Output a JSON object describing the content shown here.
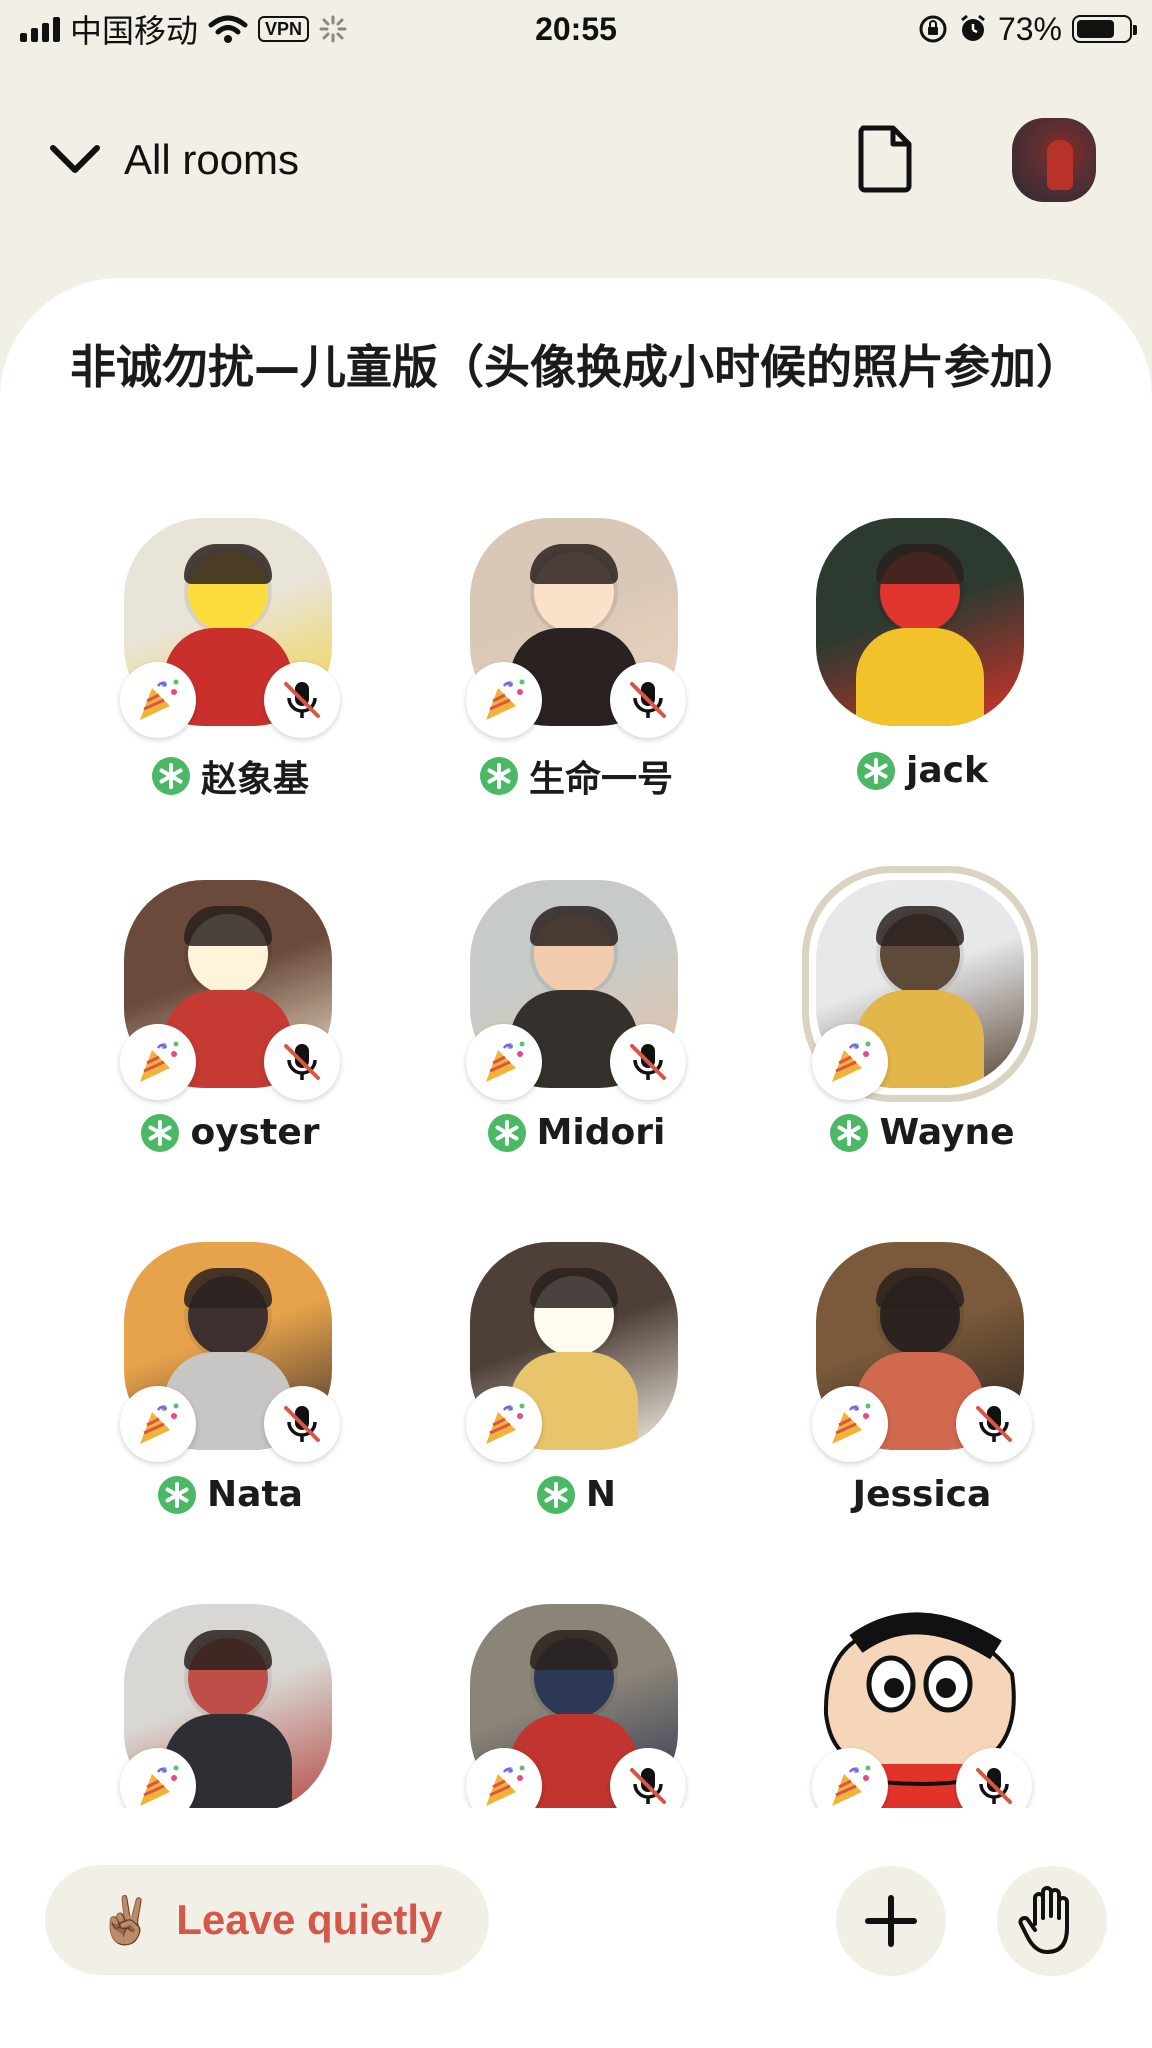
{
  "status_bar": {
    "carrier": "中国移动",
    "vpn": "VPN",
    "time": "20:55",
    "battery_percent": "73%",
    "battery_level": 0.73
  },
  "nav": {
    "all_rooms_label": "All rooms",
    "icons": [
      "chevron-down-icon",
      "document-icon"
    ]
  },
  "room": {
    "title": "非诚勿扰—儿童版（头像换成小时候的照片参加）"
  },
  "speakers": [
    {
      "name": "赵象基",
      "new_user": true,
      "muted": true,
      "party": true,
      "colors": [
        "#e9e4d8",
        "#c9302c",
        "#f1d23b"
      ]
    },
    {
      "name": "生命一号",
      "new_user": true,
      "muted": true,
      "party": true,
      "colors": [
        "#d9c8b7",
        "#2a2220",
        "#f0d6c0"
      ]
    },
    {
      "name": "jack",
      "new_user": true,
      "muted": false,
      "party": false,
      "colors": [
        "#2d3a30",
        "#f2c22a",
        "#d5332b"
      ]
    },
    {
      "name": "oyster",
      "new_user": true,
      "muted": true,
      "party": true,
      "colors": [
        "#6a4a3a",
        "#c63a34",
        "#f3e7cf"
      ]
    },
    {
      "name": "Midori",
      "new_user": true,
      "muted": true,
      "party": true,
      "colors": [
        "#c7cbc8",
        "#35302b",
        "#e7c2a5"
      ]
    },
    {
      "name": "Wayne",
      "new_user": true,
      "muted": false,
      "party": true,
      "ring": true,
      "colors": [
        "#e6e8ea",
        "#e3b64a",
        "#5a4636"
      ]
    },
    {
      "name": "Nata",
      "new_user": true,
      "muted": true,
      "party": true,
      "colors": [
        "#e7a34b",
        "#c8c6c4",
        "#3a2e2d"
      ]
    },
    {
      "name": "N",
      "new_user": true,
      "muted": false,
      "party": true,
      "colors": [
        "#4e3f39",
        "#e8c56a",
        "#f3efe4"
      ]
    },
    {
      "name": "Jessica",
      "new_user": false,
      "muted": true,
      "party": true,
      "colors": [
        "#7a5a3a",
        "#d0694e",
        "#2a211f"
      ]
    },
    {
      "name": "",
      "new_user": false,
      "muted": false,
      "party": true,
      "colors": [
        "#d9d7d3",
        "#2e2e35",
        "#b54a44"
      ]
    },
    {
      "name": "",
      "new_user": false,
      "muted": true,
      "party": true,
      "colors": [
        "#8b8478",
        "#c2342f",
        "#2b3550"
      ]
    },
    {
      "name": "",
      "new_user": false,
      "muted": true,
      "party": true,
      "cartoon": true,
      "colors": [
        "#f5d6b9",
        "#e2332b",
        "#111111"
      ]
    }
  ],
  "bottom": {
    "leave_emoji": "✌🏽",
    "leave_label": "Leave quietly",
    "add_icon": "plus-icon",
    "raise_hand_icon": "raise-hand-icon"
  },
  "colors": {
    "background": "#f1efe6",
    "accent_red": "#d4574b",
    "new_user_green": "#4bb865"
  }
}
